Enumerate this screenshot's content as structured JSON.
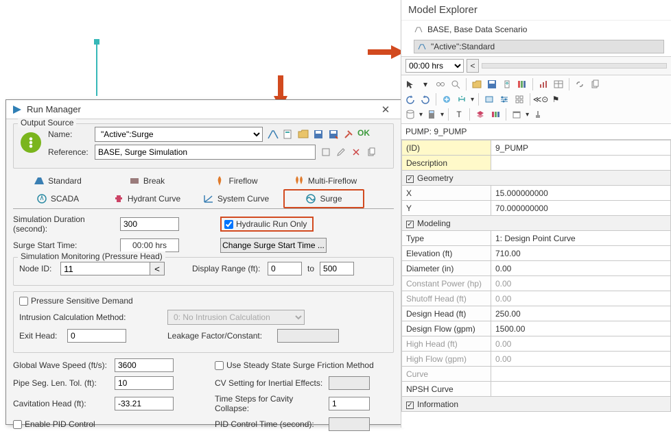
{
  "run_manager": {
    "title": "Run Manager",
    "output_source_label": "Output Source",
    "name_label": "Name:",
    "name_value": "\"Active\":Surge",
    "reference_label": "Reference:",
    "reference_value": "BASE, Surge Simulation",
    "ok_label": "OK",
    "tabs": {
      "standard": "Standard",
      "break": "Break",
      "fireflow": "Fireflow",
      "multifireflow": "Multi-Fireflow",
      "scada": "SCADA",
      "hydrant": "Hydrant Curve",
      "system": "System Curve",
      "surge": "Surge"
    },
    "sim_duration_label": "Simulation Duration (second):",
    "sim_duration_value": "300",
    "hydraulic_run_only": "Hydraulic Run Only",
    "surge_start_label": "Surge Start Time:",
    "surge_start_value": "00:00 hrs",
    "change_surge_btn": "Change Surge Start Time ...",
    "sim_mon_label": "Simulation Monitoring (Pressure Head)",
    "node_id_label": "Node ID:",
    "node_id_value": "11",
    "display_range_label": "Display Range (ft):",
    "display_range_from": "0",
    "display_range_to_label": "to",
    "display_range_to": "500",
    "pressure_sensitive": "Pressure Sensitive Demand",
    "intrusion_method_label": "Intrusion Calculation Method:",
    "intrusion_method_value": "0: No Intrusion Calculation",
    "exit_head_label": "Exit Head:",
    "exit_head_value": "0",
    "leakage_label": "Leakage Factor/Constant:",
    "leakage_value": "",
    "global_wave_label": "Global Wave Speed (ft/s):",
    "global_wave_value": "3600",
    "steady_state": "Use Steady State Surge Friction Method",
    "pipe_seg_label": "Pipe Seg. Len. Tol. (ft):",
    "pipe_seg_value": "10",
    "cv_setting_label": "CV Setting for Inertial Effects:",
    "cv_setting_value": "",
    "cavitation_label": "Cavitation Head (ft):",
    "cavitation_value": "-33.21",
    "time_steps_label": "Time Steps for Cavity Collapse:",
    "time_steps_value": "1",
    "enable_pid": "Enable PID Control",
    "pid_time_label": "PID Control Time (second):",
    "pid_time_value": ""
  },
  "model_explorer": {
    "title": "Model Explorer",
    "tree": {
      "base": "BASE, Base Data Scenario",
      "active": "\"Active\":Standard"
    },
    "time_value": "00:00 hrs",
    "pump_header": "PUMP: 9_PUMP",
    "props": {
      "id_label": "(ID)",
      "id_value": "9_PUMP",
      "desc_label": "Description",
      "geometry_label": "Geometry",
      "x_label": "X",
      "x_value": "15.000000000",
      "y_label": "Y",
      "y_value": "70.000000000",
      "modeling_label": "Modeling",
      "type_label": "Type",
      "type_value": "1: Design Point Curve",
      "elevation_label": "Elevation (ft)",
      "elevation_value": "710.00",
      "diameter_label": "Diameter (in)",
      "diameter_value": "0.00",
      "constpower_label": "Constant Power (hp)",
      "constpower_value": "0.00",
      "shutoff_label": "Shutoff Head (ft)",
      "shutoff_value": "0.00",
      "designhead_label": "Design Head (ft)",
      "designhead_value": "250.00",
      "designflow_label": "Design Flow (gpm)",
      "designflow_value": "1500.00",
      "highhead_label": "High Head (ft)",
      "highhead_value": "0.00",
      "highflow_label": "High Flow (gpm)",
      "highflow_value": "0.00",
      "curve_label": "Curve",
      "npsh_label": "NPSH Curve",
      "info_label": "Information"
    }
  }
}
